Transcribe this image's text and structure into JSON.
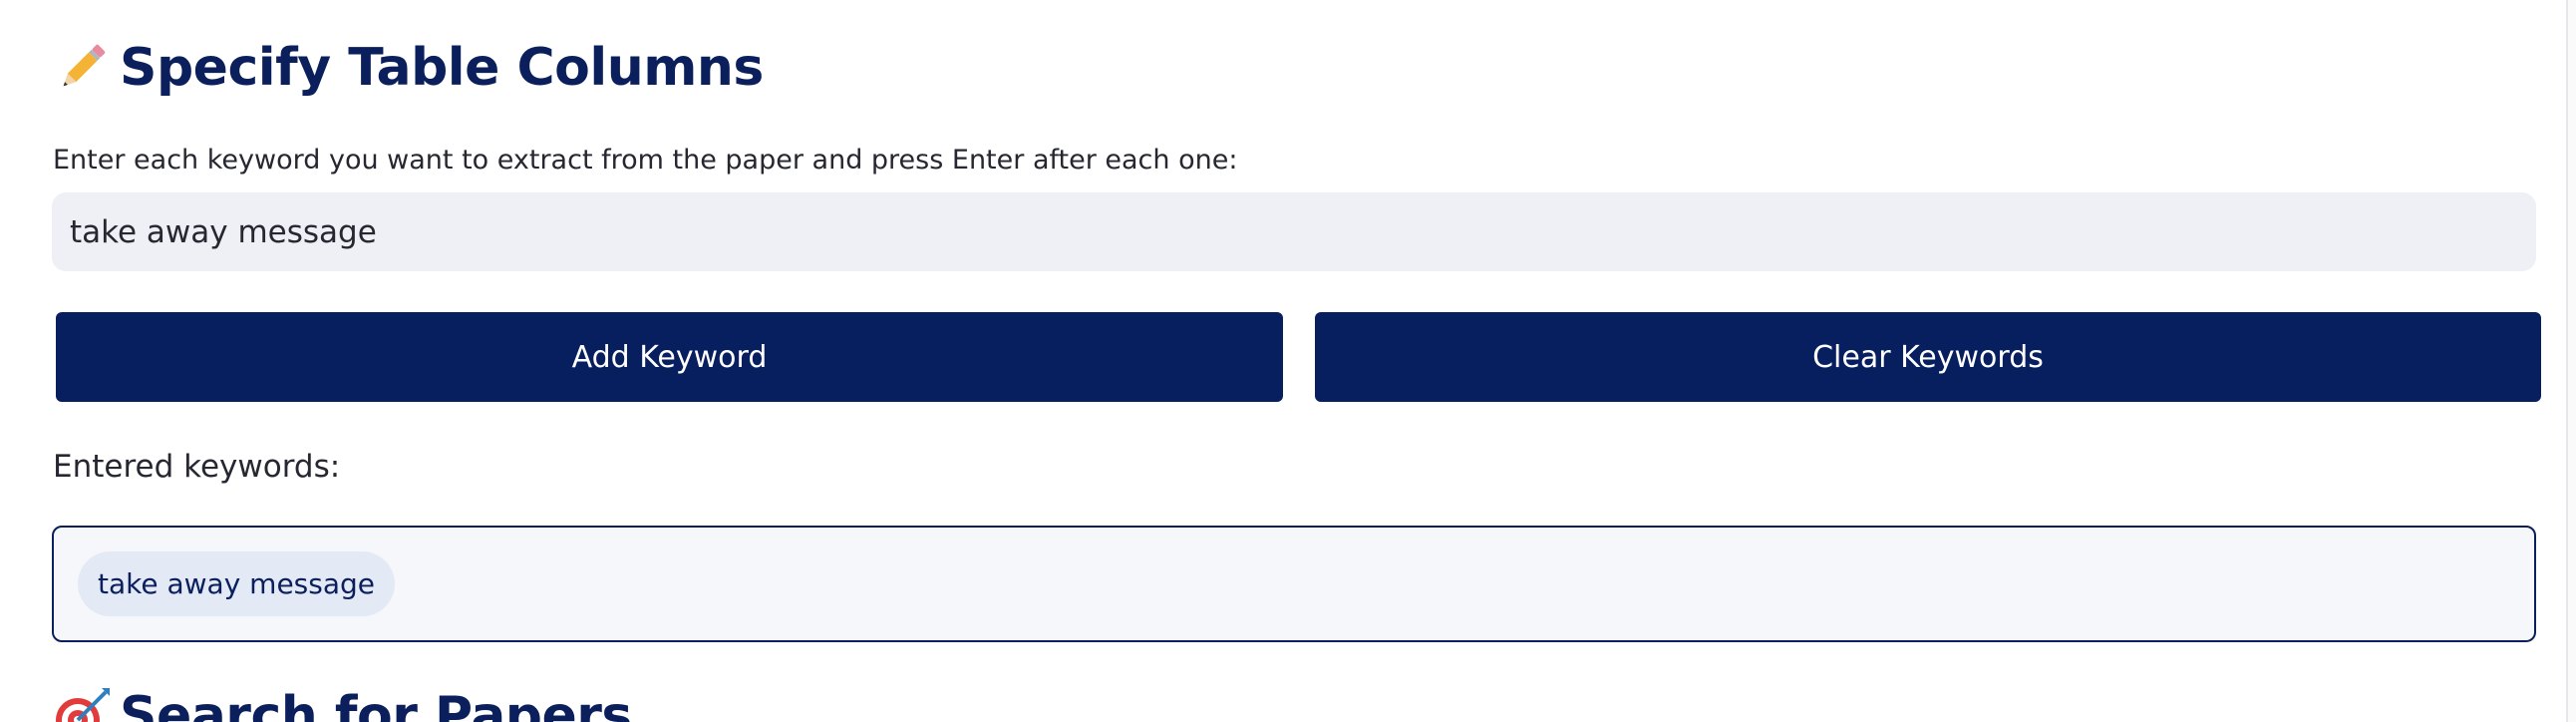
{
  "section1": {
    "heading": "Specify Table Columns",
    "emoji_icon": "pencil-icon"
  },
  "keyword_input": {
    "label": "Enter each keyword you want to extract from the paper and press Enter after each one:",
    "value": "take away message",
    "placeholder": ""
  },
  "buttons": {
    "add_label": "Add Keyword",
    "clear_label": "Clear Keywords"
  },
  "entered": {
    "label": "Entered keywords:",
    "keywords": [
      "take away message"
    ]
  },
  "section2": {
    "heading": "Search for Papers",
    "emoji_icon": "target-icon"
  },
  "colors": {
    "primary": "#071f5e",
    "heading": "#0a1f5c",
    "input_bg": "#eff0f5",
    "chip_bg": "#e3e9f5"
  }
}
